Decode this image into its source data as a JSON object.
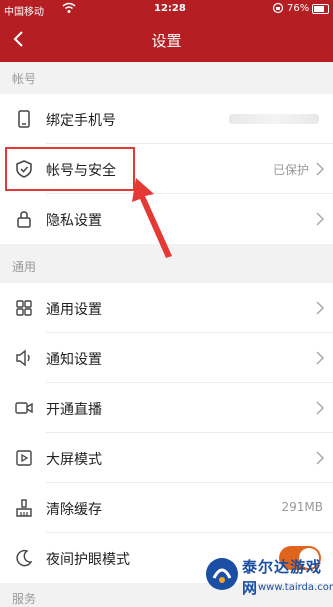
{
  "status_bar": {
    "carrier": "中国移动",
    "time": "12:28",
    "battery": "76%"
  },
  "nav": {
    "title": "设置"
  },
  "sections": {
    "account": "帐号",
    "general": "通用",
    "service_partial": "服务"
  },
  "rows": [
    {
      "label": "绑定手机号",
      "icon": "phone-icon",
      "value": ""
    },
    {
      "label": "帐号与安全",
      "icon": "shield-icon",
      "value": "已保护"
    },
    {
      "label": "隐私设置",
      "icon": "lock-icon",
      "value": ""
    },
    {
      "label": "通用设置",
      "icon": "grid-icon",
      "value": ""
    },
    {
      "label": "通知设置",
      "icon": "speaker-icon",
      "value": ""
    },
    {
      "label": "开通直播",
      "icon": "video-camera-icon",
      "value": ""
    },
    {
      "label": "大屏模式",
      "icon": "play-screen-icon",
      "value": ""
    },
    {
      "label": "清除缓存",
      "icon": "broom-icon",
      "value": "291MB"
    },
    {
      "label": "夜间护眼模式",
      "icon": "moon-icon",
      "value": ""
    }
  ],
  "night_mode_on": true,
  "colors": {
    "header": "#b51f24",
    "highlight": "#e53935",
    "toggle_on": "#e0651c"
  },
  "watermark": {
    "text": "泰尔达游戏网",
    "url": "www.tairda.com"
  }
}
